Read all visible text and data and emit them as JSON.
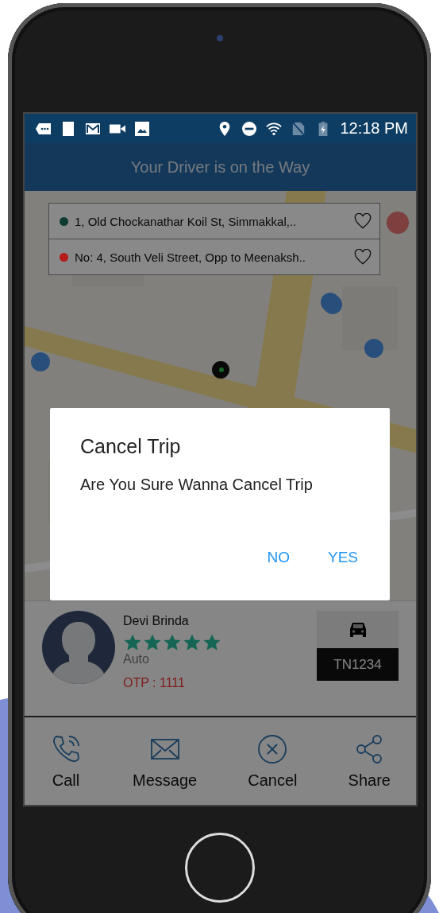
{
  "status_bar": {
    "time": "12:18 PM"
  },
  "header": {
    "title": "Your Driver is on the Way"
  },
  "addresses": [
    {
      "text": "1, Old Chockanathar Koil St, Simmakkal,..",
      "color": "#0f3b33"
    },
    {
      "text": "No: 4, South Veli Street, Opp to Meenaksh..",
      "color": "#b71c1c"
    }
  ],
  "driver": {
    "name": "Devi  Brinda",
    "stars": 5,
    "vehicle_type": "Auto",
    "otp": "OTP : 1111",
    "plate": "TN1234"
  },
  "actions": [
    {
      "label": "Call",
      "kind": "call"
    },
    {
      "label": "Message",
      "kind": "message"
    },
    {
      "label": "Cancel",
      "kind": "cancel"
    },
    {
      "label": "Share",
      "kind": "share"
    }
  ],
  "dialog": {
    "title": "Cancel Trip",
    "message": "Are You Sure Wanna Cancel Trip",
    "buttons": [
      "NO",
      "YES"
    ]
  }
}
